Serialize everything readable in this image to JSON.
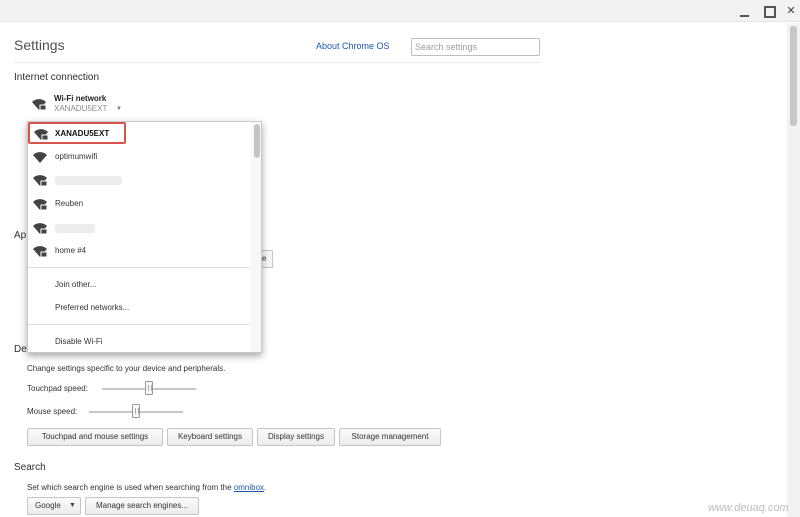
{
  "page": {
    "title": "Settings",
    "about_link": "About Chrome OS",
    "search_placeholder": "Search settings"
  },
  "internet": {
    "heading": "Internet connection",
    "network_type": "Wi-Fi network",
    "current_ssid": "XANADU5EXT"
  },
  "wifi_menu": {
    "networks": [
      {
        "name": "XANADU5EXT",
        "selected": true,
        "secured": true,
        "icon": "wifi-lock-icon"
      },
      {
        "name": "optimumwifi",
        "selected": false,
        "secured": false,
        "icon": "wifi-icon"
      },
      {
        "name": "",
        "selected": false,
        "secured": true,
        "icon": "wifi-lock-icon"
      },
      {
        "name": "Reuben",
        "selected": false,
        "secured": true,
        "icon": "wifi-lock-icon"
      },
      {
        "name": "",
        "selected": false,
        "secured": true,
        "icon": "wifi-lock-icon"
      },
      {
        "name": "home #4",
        "selected": false,
        "secured": true,
        "icon": "wifi-lock-icon"
      }
    ],
    "join_other": "Join other...",
    "preferred": "Preferred networks...",
    "disable": "Disable Wi-Fi"
  },
  "partial": {
    "appearance_heading": "Ap",
    "appearance_button": "e",
    "device_heading": "De"
  },
  "device": {
    "description": "Change settings specific to your device and peripherals.",
    "touchpad_label": "Touchpad speed:",
    "touchpad_speed": 0.5,
    "mouse_label": "Mouse speed:",
    "mouse_speed": 0.5,
    "buttons": [
      "Touchpad and mouse settings",
      "Keyboard settings",
      "Display settings",
      "Storage management"
    ]
  },
  "search": {
    "heading": "Search",
    "description_prefix": "Set which search engine is used when searching from the ",
    "description_link": "omnibox",
    "description_suffix": ".",
    "engine": "Google",
    "manage_button": "Manage search engines..."
  },
  "watermark": "www.deuaq.com",
  "colors": {
    "selection_border": "#d9534f",
    "link": "#1a57b5"
  }
}
